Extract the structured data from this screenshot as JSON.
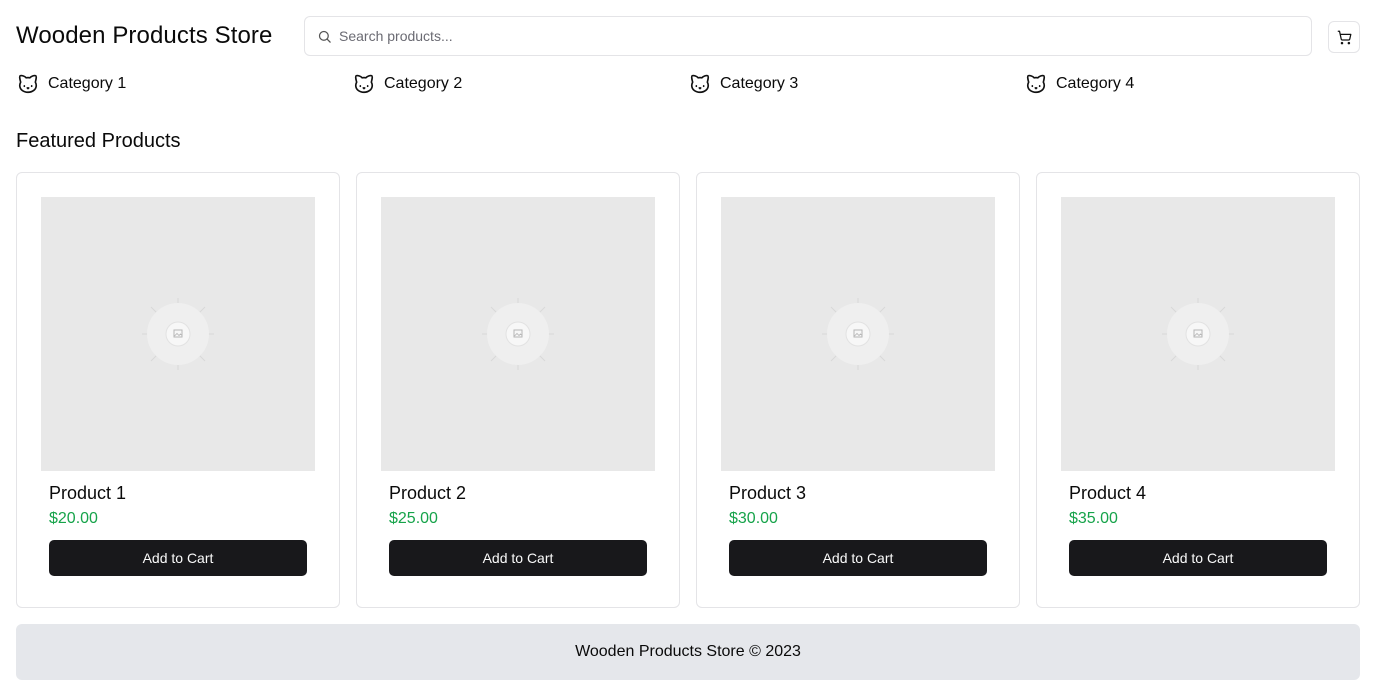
{
  "header": {
    "title": "Wooden Products Store",
    "search_placeholder": "Search products...",
    "search_icon": "search-icon",
    "cart_icon": "shopping-cart-icon"
  },
  "categories": [
    {
      "label": "Category 1",
      "icon": "cat-icon"
    },
    {
      "label": "Category 2",
      "icon": "cat-icon"
    },
    {
      "label": "Category 3",
      "icon": "cat-icon"
    },
    {
      "label": "Category 4",
      "icon": "cat-icon"
    }
  ],
  "featured": {
    "title": "Featured Products",
    "products": [
      {
        "name": "Product 1",
        "price": "$20.00",
        "button_label": "Add to Cart"
      },
      {
        "name": "Product 2",
        "price": "$25.00",
        "button_label": "Add to Cart"
      },
      {
        "name": "Product 3",
        "price": "$30.00",
        "button_label": "Add to Cart"
      },
      {
        "name": "Product 4",
        "price": "$35.00",
        "button_label": "Add to Cart"
      }
    ]
  },
  "footer": {
    "text": "Wooden Products Store © 2023"
  },
  "colors": {
    "price": "#16a34a",
    "button_bg": "#18181b",
    "footer_bg": "#e5e7eb",
    "image_placeholder": "#e8e8e8"
  }
}
